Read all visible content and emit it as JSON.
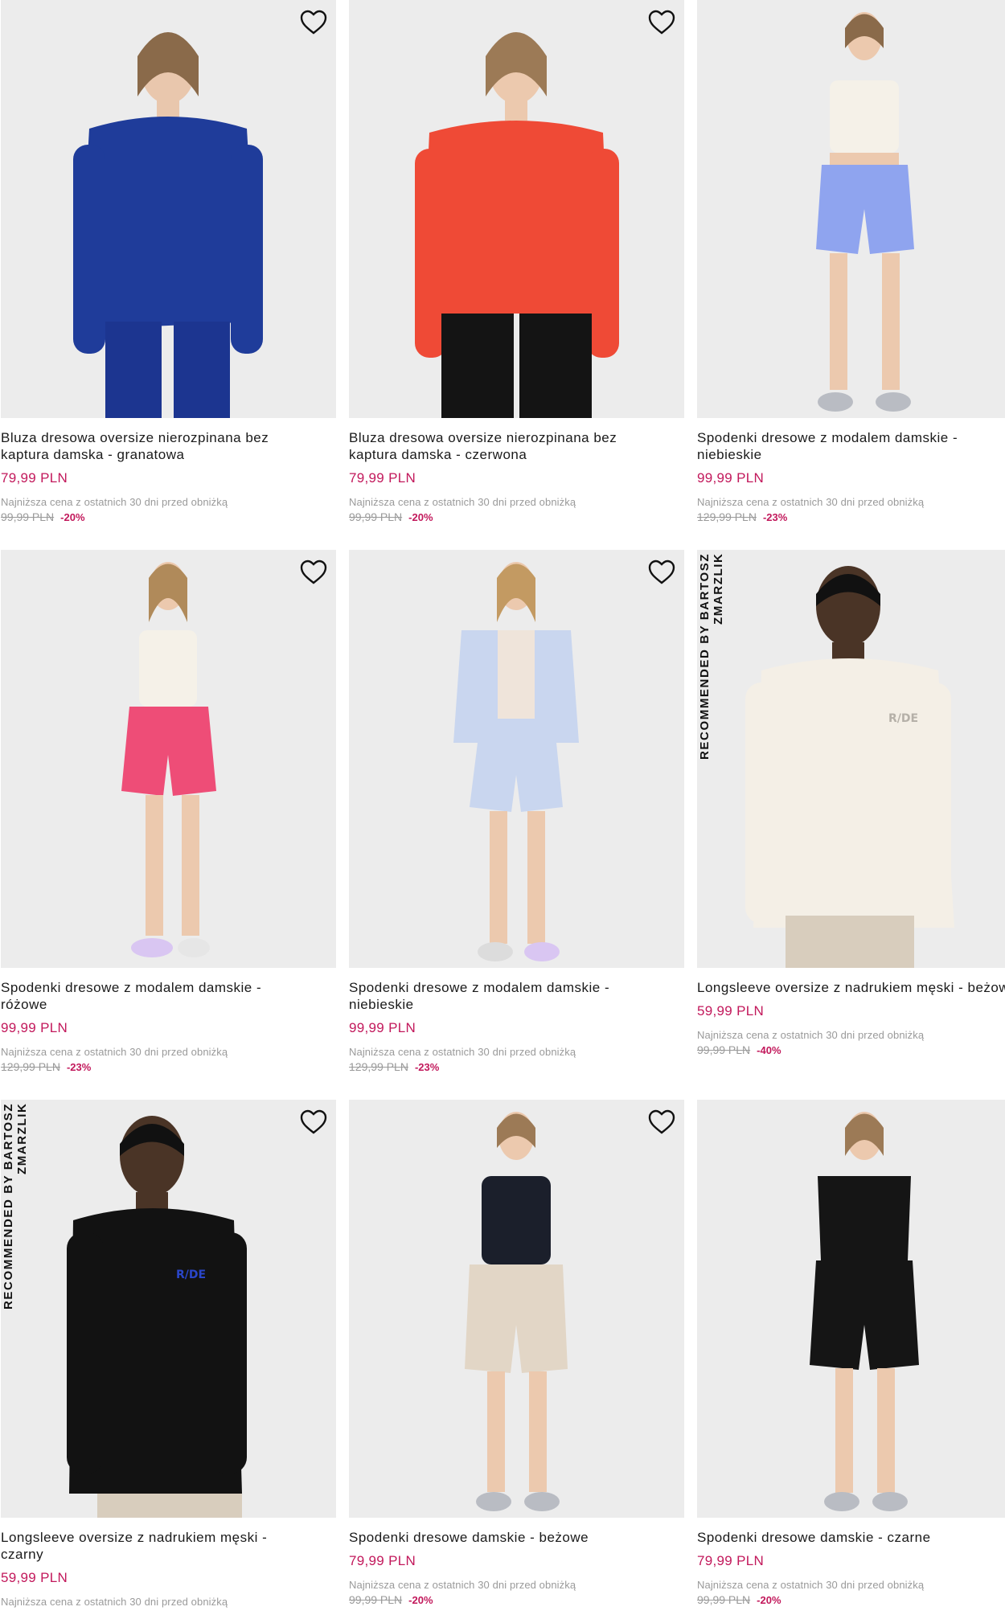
{
  "products": [
    {
      "title": "Bluza dresowa oversize nierozpinana bez kaptura damska - granatowa",
      "price": "79,99 PLN",
      "lowest_label": "Najniższa cena z ostatnich 30 dni przed obniżką",
      "old_price": "99,99 PLN",
      "discount": "-20%",
      "badge": "",
      "favorite_icon": "heart-outline-icon"
    },
    {
      "title": "Bluza dresowa oversize nierozpinana bez kaptura damska - czerwona",
      "price": "79,99 PLN",
      "lowest_label": "Najniższa cena z ostatnich 30 dni przed obniżką",
      "old_price": "99,99 PLN",
      "discount": "-20%",
      "badge": "",
      "favorite_icon": "heart-outline-icon"
    },
    {
      "title": "Spodenki dresowe z modalem damskie - niebieskie",
      "price": "99,99 PLN",
      "lowest_label": "Najniższa cena z ostatnich 30 dni przed obniżką",
      "old_price": "129,99 PLN",
      "discount": "-23%",
      "badge": "",
      "favorite_icon": "heart-outline-icon"
    },
    {
      "title": "Spodenki dresowe z modalem damskie - różowe",
      "price": "99,99 PLN",
      "lowest_label": "Najniższa cena z ostatnich 30 dni przed obniżką",
      "old_price": "129,99 PLN",
      "discount": "-23%",
      "badge": "",
      "favorite_icon": "heart-outline-icon"
    },
    {
      "title": "Spodenki dresowe z modalem damskie - niebieskie",
      "price": "99,99 PLN",
      "lowest_label": "Najniższa cena z ostatnich 30 dni przed obniżką",
      "old_price": "129,99 PLN",
      "discount": "-23%",
      "badge": "",
      "favorite_icon": "heart-outline-icon"
    },
    {
      "title": "Longsleeve oversize z nadrukiem męski - beżowy",
      "price": "59,99 PLN",
      "lowest_label": "Najniższa cena z ostatnich 30 dni przed obniżką",
      "old_price": "99,99 PLN",
      "discount": "-40%",
      "badge": "RECOMMENDED BY BARTOSZ ZMARZLIK",
      "favorite_icon": "heart-outline-icon"
    },
    {
      "title": "Longsleeve oversize z nadrukiem męski - czarny",
      "price": "59,99 PLN",
      "lowest_label": "Najniższa cena z ostatnich 30 dni przed obniżką",
      "old_price": "",
      "discount": "",
      "badge": "RECOMMENDED BY BARTOSZ ZMARZLIK",
      "favorite_icon": "heart-outline-icon"
    },
    {
      "title": "Spodenki dresowe damskie - beżowe",
      "price": "79,99 PLN",
      "lowest_label": "Najniższa cena z ostatnich 30 dni przed obniżką",
      "old_price": "99,99 PLN",
      "discount": "-20%",
      "badge": "",
      "favorite_icon": "heart-outline-icon"
    },
    {
      "title": "Spodenki dresowe damskie - czarne",
      "price": "79,99 PLN",
      "lowest_label": "Najniższa cena z ostatnich 30 dni przed obniżką",
      "old_price": "99,99 PLN",
      "discount": "-20%",
      "badge": "",
      "favorite_icon": "heart-outline-icon"
    }
  ],
  "colors": {
    "price": "#c2185b",
    "muted": "#9a9a9a",
    "image_bg": "#ececec",
    "outfits": [
      "#1f3c9a",
      "#ef4a36",
      "#8fa4ef",
      "#ee4d77",
      "#c9d6ef",
      "#f4efe6",
      "#121212",
      "#e2d6c6",
      "#151515"
    ]
  }
}
